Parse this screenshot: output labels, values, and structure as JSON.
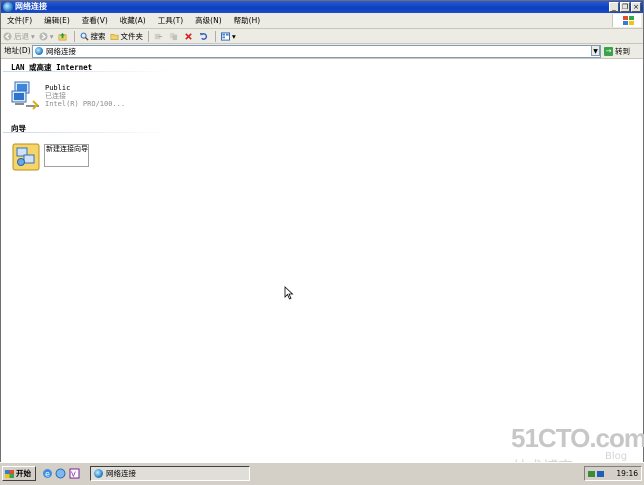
{
  "window": {
    "title": "网络连接"
  },
  "menubar": [
    "文件(F)",
    "编辑(E)",
    "查看(V)",
    "收藏(A)",
    "工具(T)",
    "高级(N)",
    "帮助(H)"
  ],
  "toolbar": {
    "back": "后退",
    "search": "搜索",
    "folders": "文件夹"
  },
  "address": {
    "label": "地址(D)",
    "value": "网络连接",
    "go": "转到"
  },
  "groups": [
    {
      "title": "LAN 或高速 Internet"
    },
    {
      "title": "向导"
    }
  ],
  "connection": {
    "name": "Public",
    "status": "已连接",
    "device": "Intel(R) PRO/100..."
  },
  "wizard": {
    "label": "新建连接向导"
  },
  "taskbar": {
    "start": "开始",
    "task": "网络连接",
    "clock": "19:16"
  },
  "watermark": {
    "line1": "51CTO.com",
    "line2": "技术博客",
    "line3": "Blog"
  },
  "colors": {
    "titlebar": "#0a3fbd",
    "chrome": "#ecebe4",
    "taskbar": "#d4d0c8"
  }
}
